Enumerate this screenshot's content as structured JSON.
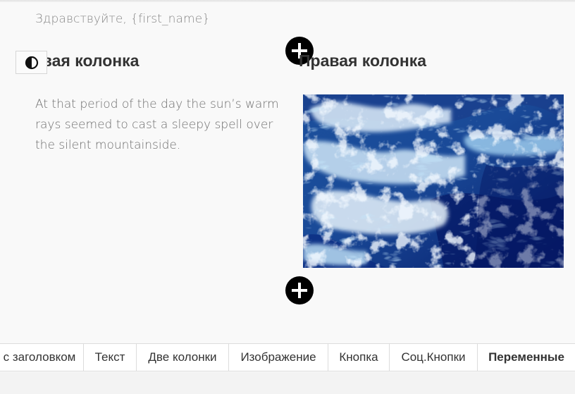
{
  "greeting": "Здравствуйте, {first_name}",
  "columns": {
    "left_title": "евая колонка",
    "right_title": "Правая колонка",
    "left_text": "At that period of the day the sun’s warm rays seemed to cast a sleepy spell over the silent mountainside."
  },
  "icons": {
    "contrast": "contrast-icon",
    "add": "plus-icon",
    "image": "ocean-waves-image"
  },
  "tabs": [
    {
      "label": "с заголовком",
      "active": false
    },
    {
      "label": "Текст",
      "active": false
    },
    {
      "label": "Две колонки",
      "active": false
    },
    {
      "label": "Изображение",
      "active": false
    },
    {
      "label": "Кнопка",
      "active": false
    },
    {
      "label": "Соц.Кнопки",
      "active": false
    },
    {
      "label": "Переменные",
      "active": true
    }
  ],
  "colors": {
    "background": "#f9f9f9",
    "heading": "#333333",
    "body_text": "#6e6e6e",
    "add_button": "#000000",
    "sea_dark": "#0a2a7a",
    "sea_foam": "#e8f2fb"
  }
}
